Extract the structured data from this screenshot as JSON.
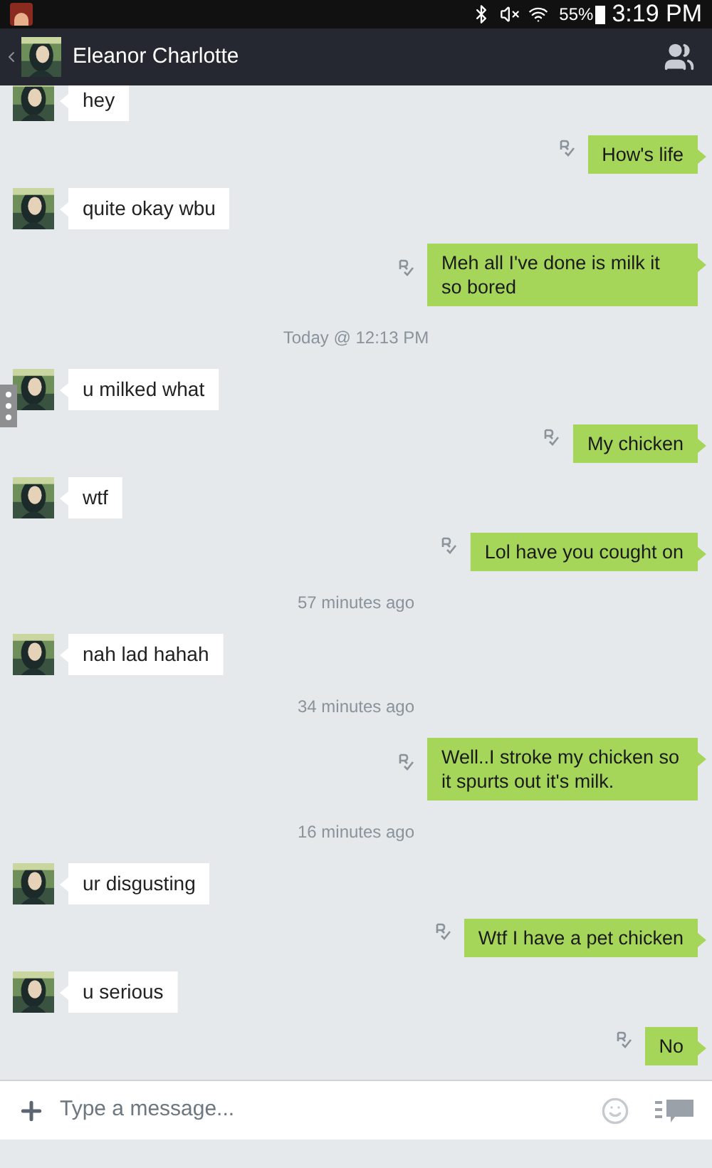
{
  "status_bar": {
    "battery": "55%",
    "time": "3:19 PM"
  },
  "header": {
    "name": "Eleanor Charlotte"
  },
  "messages": [
    {
      "kind": "in",
      "text": "hey"
    },
    {
      "kind": "out",
      "text": "How's life"
    },
    {
      "kind": "in",
      "text": "quite okay wbu"
    },
    {
      "kind": "out",
      "text": "Meh all I've done is milk it so bored"
    },
    {
      "kind": "time",
      "text": "Today @ 12:13 PM"
    },
    {
      "kind": "in",
      "text": "u milked what"
    },
    {
      "kind": "out",
      "text": "My chicken"
    },
    {
      "kind": "in",
      "text": "wtf"
    },
    {
      "kind": "out",
      "text": "Lol have you cought on"
    },
    {
      "kind": "time",
      "text": "57 minutes ago"
    },
    {
      "kind": "in",
      "text": "nah lad hahah"
    },
    {
      "kind": "time",
      "text": "34 minutes ago"
    },
    {
      "kind": "out",
      "text": "Well..I stroke my chicken so it spurts out it's milk."
    },
    {
      "kind": "time",
      "text": "16 minutes ago"
    },
    {
      "kind": "in",
      "text": "ur disgusting"
    },
    {
      "kind": "out",
      "text": "Wtf I have a pet chicken"
    },
    {
      "kind": "in",
      "text": "u serious"
    },
    {
      "kind": "out",
      "text": "No"
    }
  ],
  "composer": {
    "placeholder": "Type a message..."
  }
}
